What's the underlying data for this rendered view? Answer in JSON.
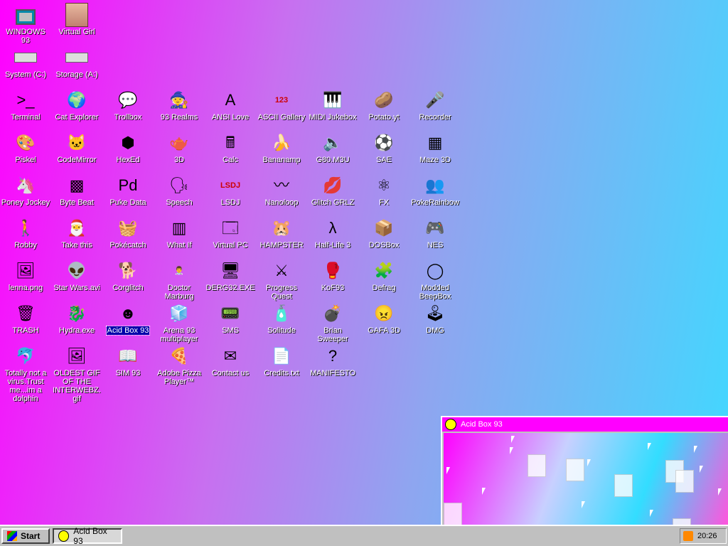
{
  "desktop": {
    "icons": [
      {
        "label": "WINDOWS 93",
        "glyph": "pc-icon",
        "char": ""
      },
      {
        "label": "Virtual Girl",
        "glyph": "face-icon",
        "char": ""
      },
      {
        "label": "System (C:)",
        "glyph": "hard-drive-icon",
        "char": ""
      },
      {
        "label": "Storage (A:)",
        "glyph": "floppy-drive-icon",
        "char": "⌸"
      },
      {
        "label": "Terminal",
        "glyph": "terminal-icon",
        "char": ">_"
      },
      {
        "label": "Cat Explorer",
        "glyph": "cat-globe-icon",
        "char": "🌍"
      },
      {
        "label": "Trollbox",
        "glyph": "chat-bubble-icon",
        "char": "💬"
      },
      {
        "label": "93 Realms",
        "glyph": "wizard-icon",
        "char": "🧙"
      },
      {
        "label": "ANSI Love",
        "glyph": "letter-a-icon",
        "char": "A"
      },
      {
        "label": "ASCII Gallery",
        "glyph": "123-icon",
        "char": "123"
      },
      {
        "label": "MIDI Jukebox",
        "glyph": "piano-keys-icon",
        "char": "🎹"
      },
      {
        "label": "Potato.yt",
        "glyph": "potato-icon",
        "char": "🥔"
      },
      {
        "label": "Recorder",
        "glyph": "microphone-icon",
        "char": "🎤"
      },
      {
        "label": "Piskel",
        "glyph": "palette-icon",
        "char": "🎨"
      },
      {
        "label": "CodeMirror",
        "glyph": "cat-icon",
        "char": "🐱"
      },
      {
        "label": "HexEd",
        "glyph": "cube-icon",
        "char": "⬢"
      },
      {
        "label": "3D",
        "glyph": "teapot-icon",
        "char": "🫖"
      },
      {
        "label": "Calc",
        "glyph": "calculator-icon",
        "char": "🖩"
      },
      {
        "label": "Bananamp",
        "glyph": "banana-icon",
        "char": "🍌"
      },
      {
        "label": "G80.M3U",
        "glyph": "audio-file-icon",
        "char": "🔈"
      },
      {
        "label": "SAE",
        "glyph": "amiga-ball-icon",
        "char": "⚽"
      },
      {
        "label": "Maze 3D",
        "glyph": "maze-icon",
        "char": "▦"
      },
      {
        "label": "Poney Jockey",
        "glyph": "pony-icon",
        "char": "🦄"
      },
      {
        "label": "Byte Beat",
        "glyph": "bytebeat-icon",
        "char": "▩"
      },
      {
        "label": "Puke Data",
        "glyph": "pd-icon",
        "char": "Pd"
      },
      {
        "label": "Speech",
        "glyph": "speech-face-icon",
        "char": "🗣"
      },
      {
        "label": "LSDJ",
        "glyph": "lsdj-icon",
        "char": "LSDJ"
      },
      {
        "label": "Nanoloop",
        "glyph": "nanoloop-icon",
        "char": "〰"
      },
      {
        "label": "Glitch GRLZ",
        "glyph": "lips-icon",
        "char": "💋"
      },
      {
        "label": "FX",
        "glyph": "atom-icon",
        "char": "⚛"
      },
      {
        "label": "PokeRainbow",
        "glyph": "trainers-icon",
        "char": "👥"
      },
      {
        "label": "Robby",
        "glyph": "stick-figure-icon",
        "char": "🚶"
      },
      {
        "label": "Take this",
        "glyph": "santa-icon",
        "char": "🎅"
      },
      {
        "label": "Pokécatch",
        "glyph": "basket-icon",
        "char": "🧺"
      },
      {
        "label": "What If",
        "glyph": "green-window-icon",
        "char": "▥"
      },
      {
        "label": "Virtual PC",
        "glyph": "window-icon",
        "char": "🗔"
      },
      {
        "label": "HAMPSTER",
        "glyph": "hamster-icon",
        "char": "🐹"
      },
      {
        "label": "Half-Life 3",
        "glyph": "lambda-icon",
        "char": "λ"
      },
      {
        "label": "DOSBox",
        "glyph": "dosbox-icon",
        "char": "📦"
      },
      {
        "label": "NES",
        "glyph": "nes-icon",
        "char": "🎮"
      },
      {
        "label": "lenna.png",
        "glyph": "image-file-icon",
        "char": "🖼"
      },
      {
        "label": "Star Wars.avi",
        "glyph": "yoda-icon",
        "char": "👽"
      },
      {
        "label": "Corglitch",
        "glyph": "corgi-icon",
        "char": "🐕"
      },
      {
        "label": "Doctor Marburg",
        "glyph": "doctor-icon",
        "char": "👨‍⚕️"
      },
      {
        "label": "DERG32.EXE",
        "glyph": "monitor-face-icon",
        "char": "🖥"
      },
      {
        "label": "Progress Quest",
        "glyph": "swords-icon",
        "char": "⚔"
      },
      {
        "label": "KoF93",
        "glyph": "fighter-icon",
        "char": "🥊"
      },
      {
        "label": "Defrag",
        "glyph": "defrag-icon",
        "char": "🧩"
      },
      {
        "label": "Modded BeepBox",
        "glyph": "green-ring-icon",
        "char": "◯"
      },
      {
        "label": "TRASH",
        "glyph": "recycle-bin-icon",
        "char": "🗑"
      },
      {
        "label": "Hydra.exe",
        "glyph": "hydra-icon",
        "char": "🐉"
      },
      {
        "label": "Acid Box 93",
        "glyph": "blue-smiley-icon",
        "char": "☻"
      },
      {
        "label": "Arena 93 multiplayer",
        "glyph": "cube-color-icon",
        "char": "🧊"
      },
      {
        "label": "SMS",
        "glyph": "console-icon",
        "char": "📟"
      },
      {
        "label": "Solitude",
        "glyph": "bottle-icon",
        "char": "🧴"
      },
      {
        "label": "Brian Sweeper",
        "glyph": "mine-icon",
        "char": "💣"
      },
      {
        "label": "GAFA 3D",
        "glyph": "doom-face-icon",
        "char": "😠"
      },
      {
        "label": "DMG",
        "glyph": "gameboy-icon",
        "char": "🕹"
      },
      {
        "label": "Totally not a virus.Trust me...im a dolphin",
        "glyph": "dolphin-icon",
        "char": "🐬"
      },
      {
        "label": "OLDEST GIF OF THE INTERWEBZ.gif",
        "glyph": "gif-file-icon",
        "char": "🖼"
      },
      {
        "label": "SIM 93",
        "glyph": "book-icon",
        "char": "📖"
      },
      {
        "label": "Adobe Pizza Player™",
        "glyph": "pizza-icon",
        "char": "🍕"
      },
      {
        "label": "Contact us",
        "glyph": "letter-pen-icon",
        "char": "✉"
      },
      {
        "label": "Credits.txt",
        "glyph": "text-file-icon",
        "char": "📄"
      },
      {
        "label": "MANIFESTO",
        "glyph": "question-mark-icon",
        "char": "?"
      }
    ],
    "selected_label": "Acid Box 93"
  },
  "window": {
    "title": "Acid Box 93",
    "title_icon": "smiley-icon"
  },
  "taskbar": {
    "start_label": "Start",
    "task_label": "Acid Box 93",
    "clock": "20:26",
    "tray_icon": "rss-icon"
  },
  "colors": {
    "desktop_gradient_start": "#ff00ff",
    "desktop_gradient_end": "#3fd9ff",
    "title_bar": "#ff00ff",
    "taskbar": "#c0c0c0",
    "selection": "#0000aa"
  }
}
